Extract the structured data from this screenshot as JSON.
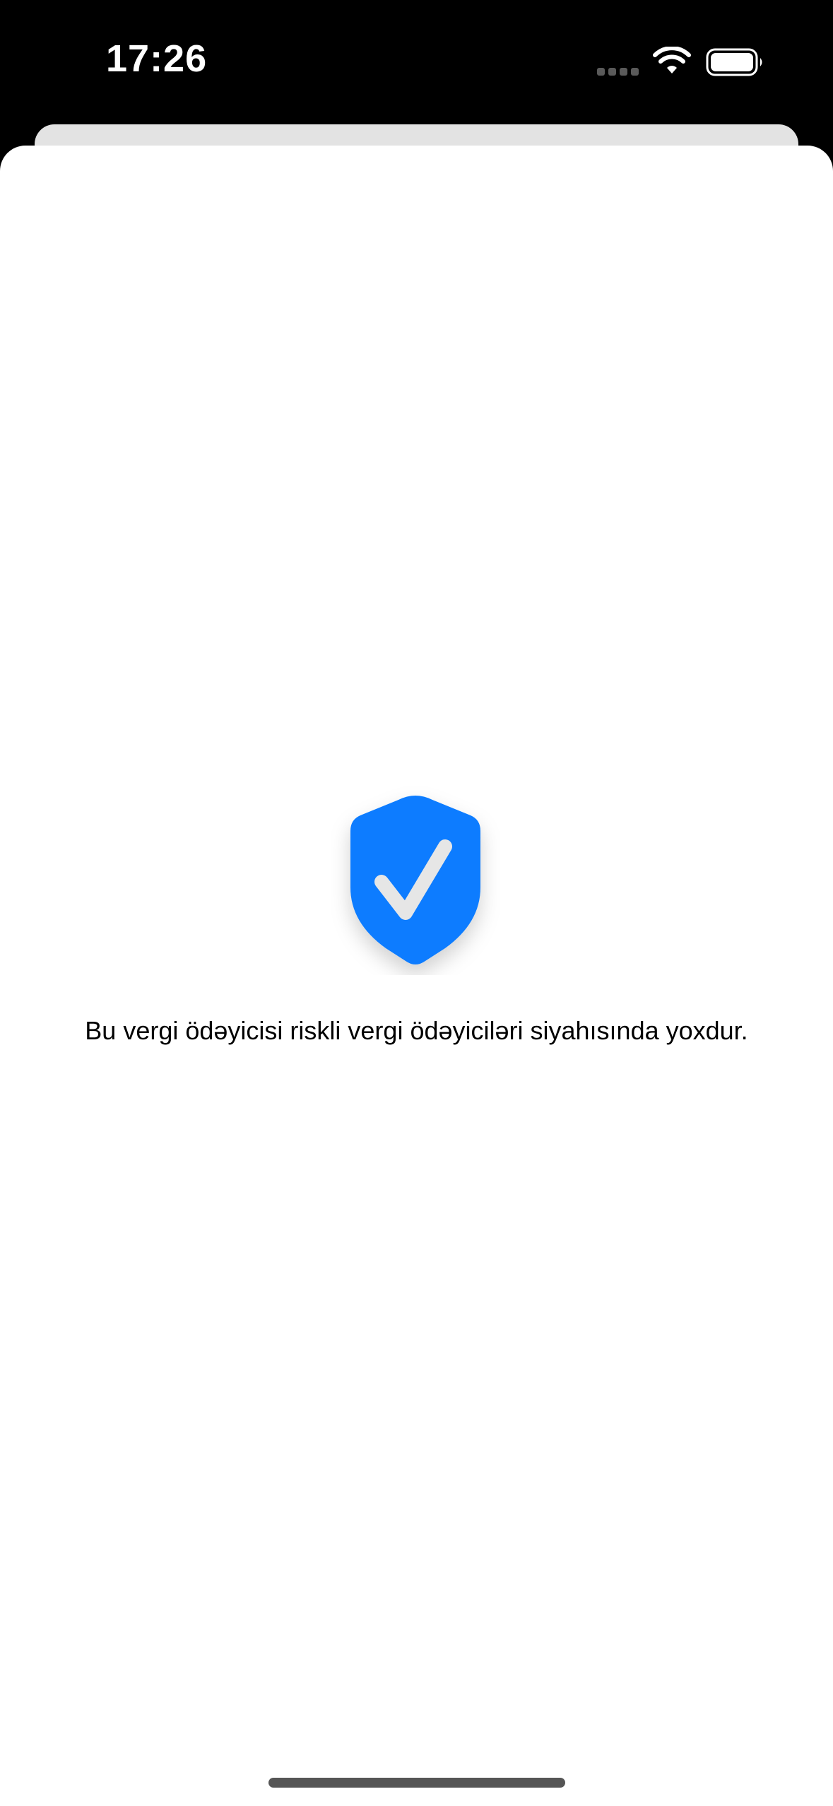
{
  "status_bar": {
    "time": "17:26",
    "signal_icon": "cellular-signal-icon",
    "wifi_icon": "wifi-icon",
    "battery_icon": "battery-icon"
  },
  "result": {
    "icon": "shield-check-icon",
    "message": "Bu vergi ödəyicisi riskli vergi ödəyiciləri siyahısında yoxdur."
  },
  "colors": {
    "accent": "#0a7cff",
    "background": "#ffffff",
    "status_bar": "#000000"
  }
}
